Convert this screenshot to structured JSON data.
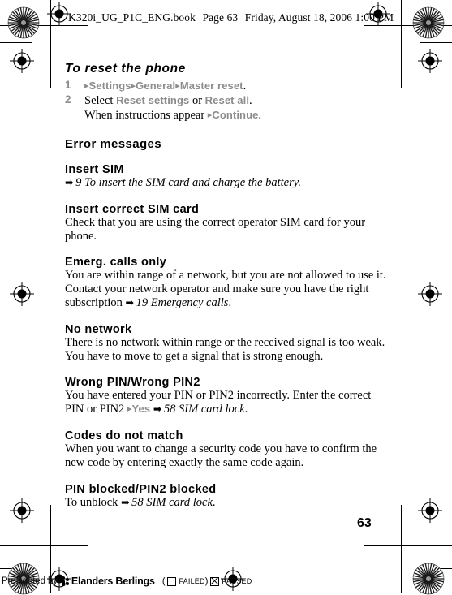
{
  "page_header": {
    "filename": "K320i_UG_P1C_ENG.book",
    "page_label": "Page 63",
    "date": "Friday, August 18, 2006 1:00 PM"
  },
  "procedure": {
    "title": "To reset the phone",
    "steps": [
      {
        "number": "1",
        "lines": [
          {
            "parts": [
              {
                "type": "tri",
                "text": "▸"
              },
              {
                "type": "menu",
                "text": "Settings"
              },
              {
                "type": "tri",
                "text": "▸"
              },
              {
                "type": "menu",
                "text": "General"
              },
              {
                "type": "tri",
                "text": "▸"
              },
              {
                "type": "menu",
                "text": "Master reset"
              },
              {
                "type": "plain",
                "text": "."
              }
            ]
          }
        ]
      },
      {
        "number": "2",
        "lines": [
          {
            "parts": [
              {
                "type": "plain",
                "text": "Select "
              },
              {
                "type": "menu",
                "text": "Reset settings"
              },
              {
                "type": "plain",
                "text": " or "
              },
              {
                "type": "menu",
                "text": "Reset all"
              },
              {
                "type": "plain",
                "text": "."
              }
            ]
          },
          {
            "parts": [
              {
                "type": "plain",
                "text": "When instructions appear "
              },
              {
                "type": "tri",
                "text": "▸"
              },
              {
                "type": "menu",
                "text": "Continue"
              },
              {
                "type": "plain",
                "text": "."
              }
            ]
          }
        ]
      }
    ]
  },
  "section": {
    "heading": "Error messages",
    "entries": [
      {
        "heading": "Insert SIM",
        "parts": [
          {
            "type": "arrow",
            "text": "➡"
          },
          {
            "type": "xref",
            "text": " 9 To insert the SIM card and charge the battery."
          }
        ]
      },
      {
        "heading": "Insert correct SIM card",
        "parts": [
          {
            "type": "plain",
            "text": "Check that you are using the correct operator SIM card for your phone."
          }
        ]
      },
      {
        "heading": "Emerg. calls only",
        "parts": [
          {
            "type": "plain",
            "text": "You are within range of a network, but you are not allowed to use it. Contact your network operator and make sure you have the right subscription "
          },
          {
            "type": "arrow",
            "text": "➡"
          },
          {
            "type": "xref",
            "text": " 19 Emergency calls"
          },
          {
            "type": "plain",
            "text": "."
          }
        ]
      },
      {
        "heading": "No network",
        "parts": [
          {
            "type": "plain",
            "text": "There is no network within range or the received signal is too weak. You have to move to get a signal that is strong enough."
          }
        ]
      },
      {
        "heading": "Wrong PIN/Wrong PIN2",
        "parts": [
          {
            "type": "plain",
            "text": "You have entered your PIN or PIN2 incorrectly. Enter the correct PIN or PIN2 "
          },
          {
            "type": "tri",
            "text": "▸"
          },
          {
            "type": "menu",
            "text": "Yes"
          },
          {
            "type": "plain",
            "text": " "
          },
          {
            "type": "arrow",
            "text": "➡"
          },
          {
            "type": "xref",
            "text": " 58 SIM card lock"
          },
          {
            "type": "plain",
            "text": "."
          }
        ]
      },
      {
        "heading": "Codes do not match",
        "parts": [
          {
            "type": "plain",
            "text": "When you want to change a security code you have to confirm the new code by entering exactly the same code again."
          }
        ]
      },
      {
        "heading": "PIN blocked/PIN2 blocked",
        "parts": [
          {
            "type": "plain",
            "text": "To unblock "
          },
          {
            "type": "arrow",
            "text": "➡"
          },
          {
            "type": "xref",
            "text": " 58 SIM card lock"
          },
          {
            "type": "plain",
            "text": "."
          }
        ]
      }
    ]
  },
  "folio": "63",
  "preflight": {
    "by_label": "Preflighted by",
    "company": "Elanders Berlings",
    "open_paren": "(",
    "failed_label": "FAILED",
    "close_paren": ")",
    "passed_label": "PASSED"
  },
  "colors": {
    "menu_gray": "#8c8c8c",
    "text_black": "#000000",
    "page_background": "#ffffff"
  }
}
